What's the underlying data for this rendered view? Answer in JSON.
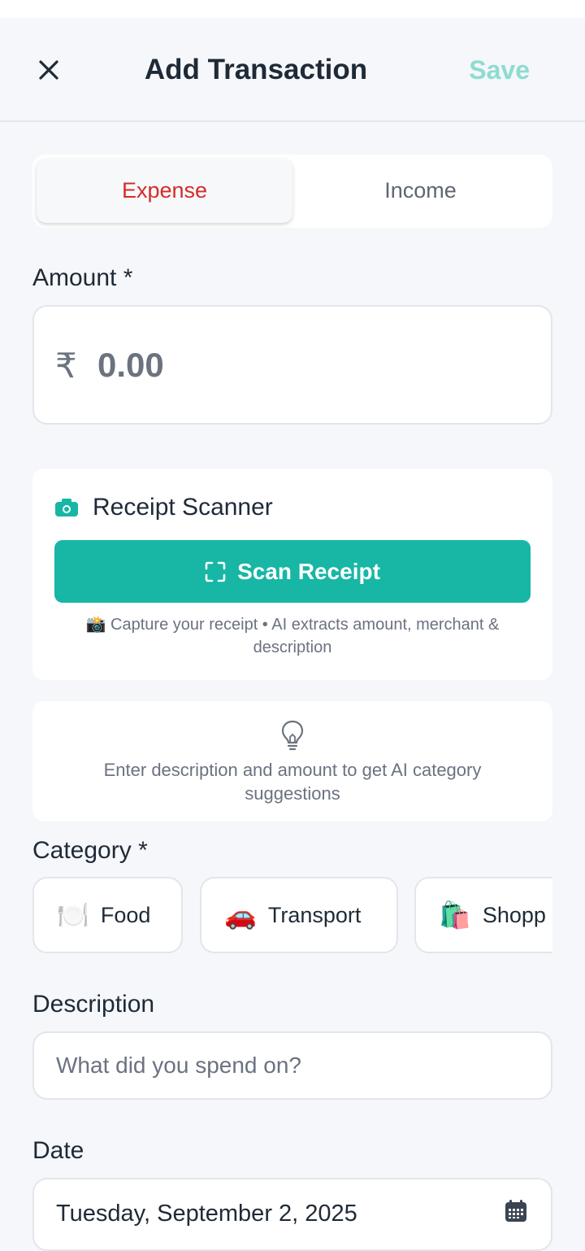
{
  "header": {
    "title": "Add Transaction",
    "save_label": "Save"
  },
  "type_toggle": {
    "expense_label": "Expense",
    "income_label": "Income",
    "selected": "Expense"
  },
  "amount": {
    "label": "Amount *",
    "currency_symbol": "₹",
    "placeholder": "0.00"
  },
  "receipt_scanner": {
    "title": "Receipt Scanner",
    "button_label": "Scan Receipt",
    "hint": "📸 Capture your receipt • AI extracts amount, merchant & description"
  },
  "ai_suggestion": {
    "icon": "lightbulb-icon",
    "text": "Enter description and amount to get AI category suggestions"
  },
  "category": {
    "label": "Category *",
    "items": [
      {
        "emoji": "🍽️",
        "label": "Food"
      },
      {
        "emoji": "🚗",
        "label": "Transport"
      },
      {
        "emoji": "🛍️",
        "label": "Shopp"
      }
    ]
  },
  "description": {
    "label": "Description",
    "placeholder": "What did you spend on?"
  },
  "date": {
    "label": "Date",
    "value": "Tuesday, September 2, 2025"
  },
  "colors": {
    "accent": "#17b6a5",
    "expense_red": "#d52b2b",
    "save_disabled": "#8ddcd0",
    "background": "#f5f7fa"
  }
}
